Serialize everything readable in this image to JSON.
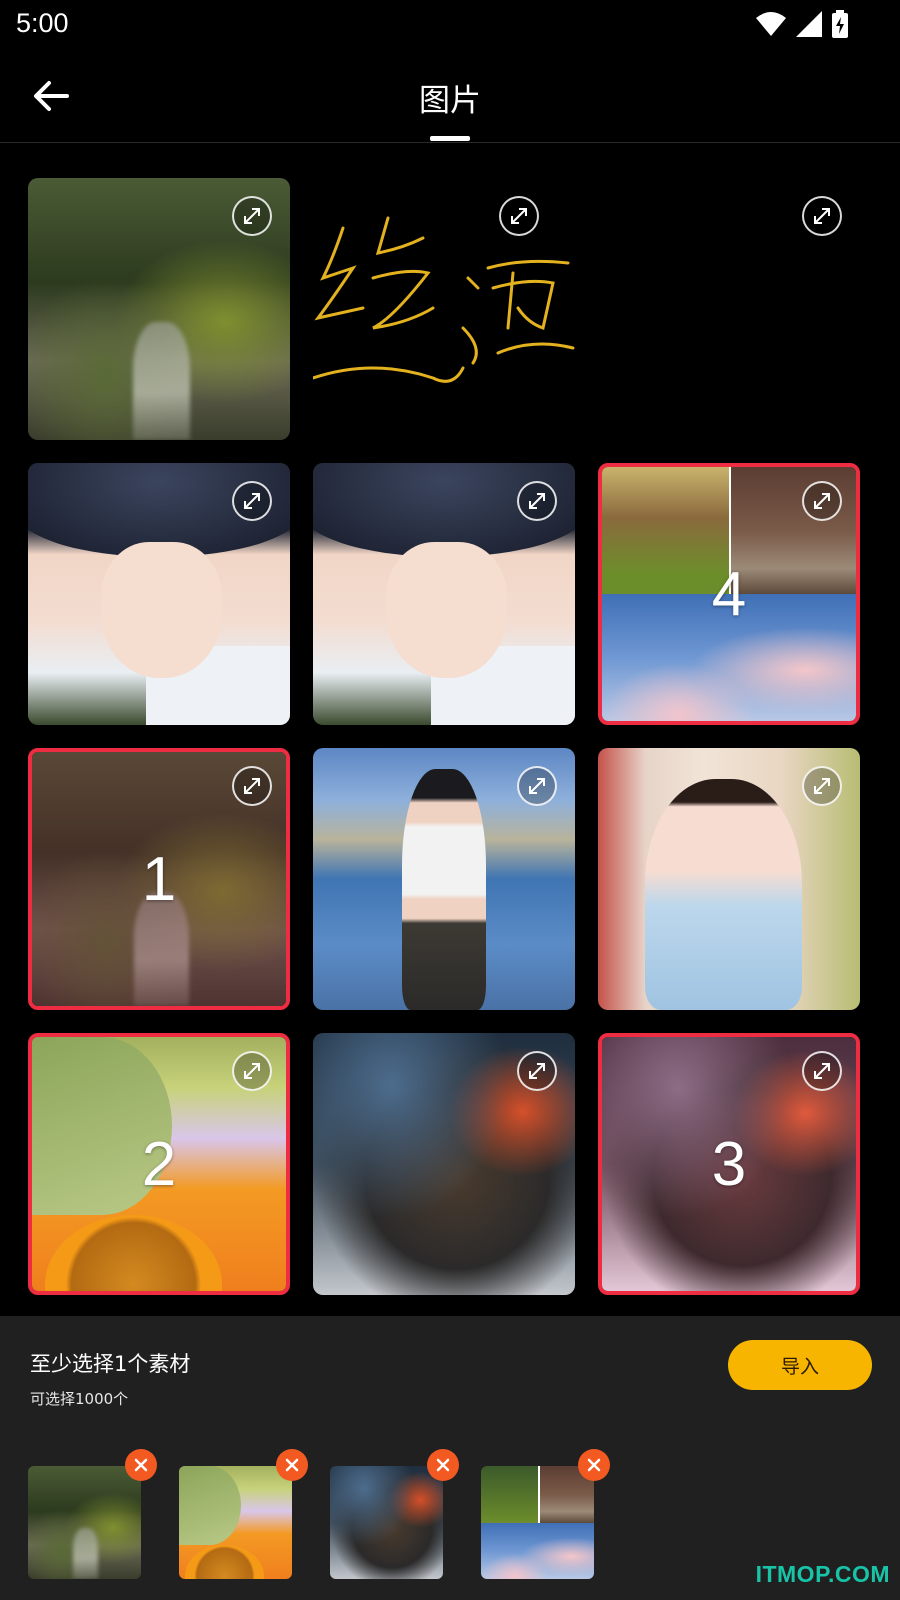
{
  "status_bar": {
    "time": "5:00"
  },
  "header": {
    "tab_title": "图片"
  },
  "grid": {
    "order_labels": [
      "4",
      "1",
      "2",
      "3"
    ]
  },
  "panel": {
    "title": "至少选择1个素材",
    "subtitle": "可选择1000个",
    "import_label": "导入"
  },
  "colors": {
    "accent": "#f7b500",
    "selected_border": "#ee2c42",
    "remove": "#f25a22",
    "watermark": "#18c4a8"
  },
  "icons": [
    "back-arrow-icon",
    "expand-icon",
    "close-icon",
    "wifi-icon",
    "signal-icon",
    "battery-icon"
  ],
  "watermark": "ITMOP.COM"
}
